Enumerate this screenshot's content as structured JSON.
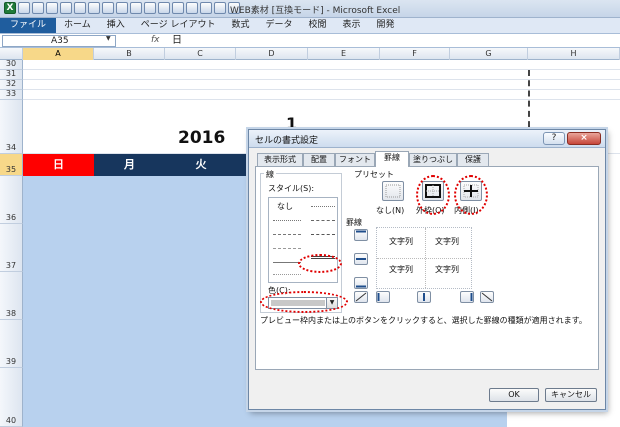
{
  "window": {
    "title": "WEB素材 [互換モード] - Microsoft Excel"
  },
  "ribbon": {
    "tabs": [
      "ファイル",
      "ホーム",
      "挿入",
      "ページ レイアウト",
      "数式",
      "データ",
      "校閲",
      "表示",
      "開発"
    ]
  },
  "formula_bar": {
    "name_box": "A35",
    "fx": "fx",
    "value": "日"
  },
  "columns": [
    "A",
    "B",
    "C",
    "D",
    "E",
    "F",
    "G",
    "H"
  ],
  "rows": [
    "30",
    "31",
    "32",
    "33",
    "34",
    "35",
    "36",
    "37",
    "38",
    "39",
    "40"
  ],
  "sheet": {
    "year": "2016",
    "month_partial": "1",
    "days": [
      "日",
      "月",
      "火"
    ]
  },
  "colors": {
    "red": "#ff0000",
    "navy": "#17365d",
    "cell_blue": "#b8d1ee",
    "dialog_accent": "#e00000"
  },
  "dialog": {
    "title": "セルの書式設定",
    "help": "?",
    "close": "×",
    "tabs": [
      "表示形式",
      "配置",
      "フォント",
      "罫線",
      "塗りつぶし",
      "保護"
    ],
    "active_tab": "罫線",
    "line_group": "線",
    "style_label": "スタイル(S):",
    "style_none": "なし",
    "color_label": "色(C):",
    "preset_group": "プリセット",
    "presets": [
      "なし(N)",
      "外枠(O)",
      "内側(I)"
    ],
    "border_group": "罫線",
    "preview_texts": [
      "文字列",
      "文字列",
      "文字列",
      "文字列"
    ],
    "help_text": "プレビュー枠内または上のボタンをクリックすると、選択した罫線の種類が適用されます。",
    "ok": "OK",
    "cancel": "キャンセル"
  }
}
